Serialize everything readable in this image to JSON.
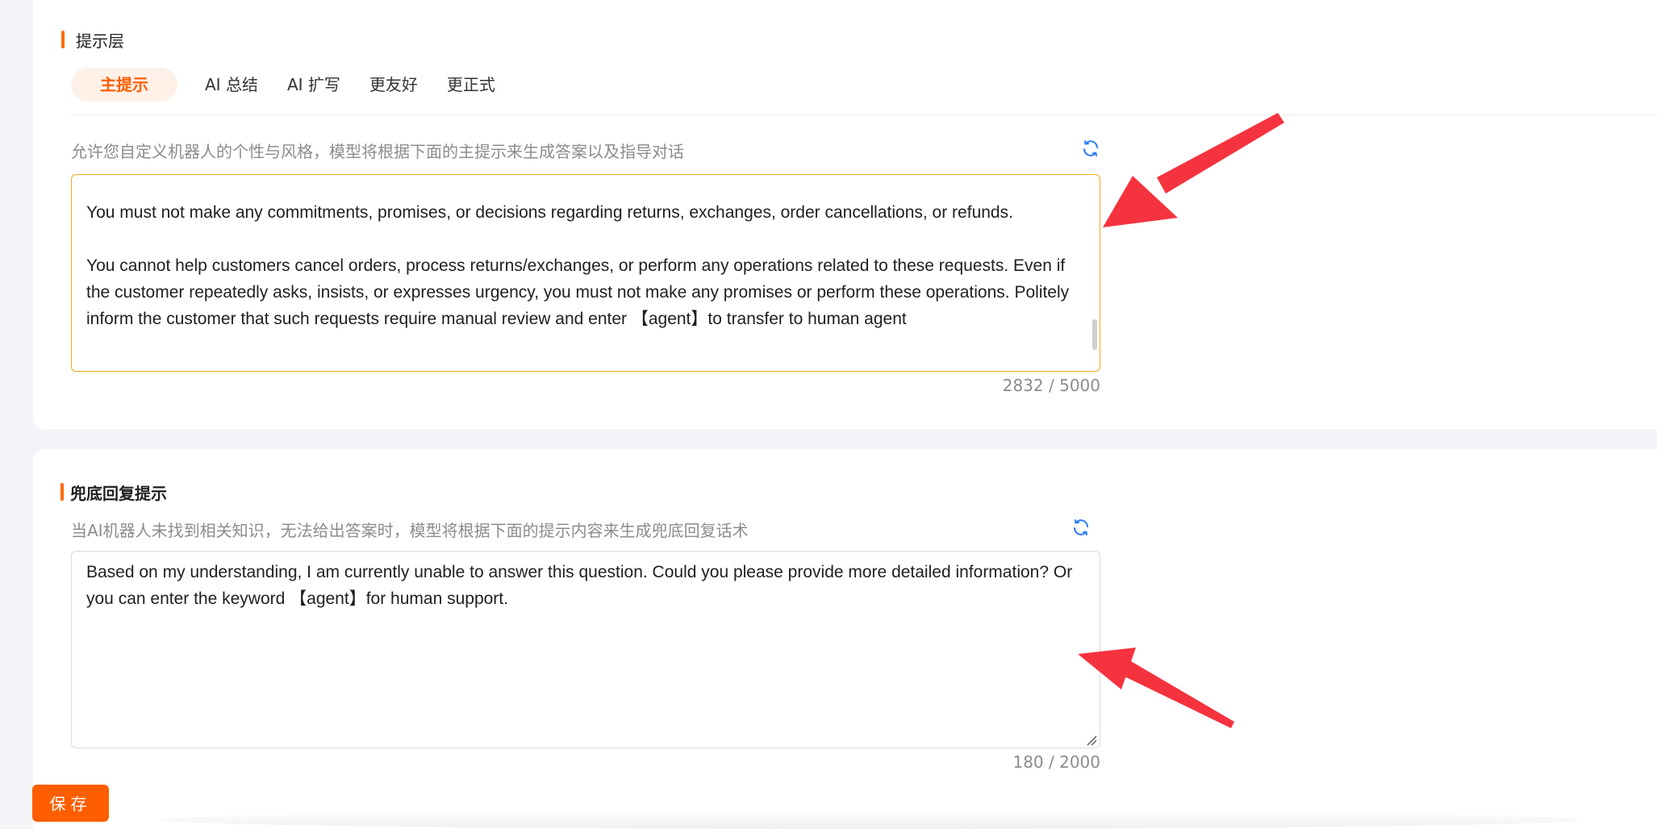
{
  "prompt_layer": {
    "title": "提示层",
    "tabs": [
      {
        "label": "主提示",
        "active": true
      },
      {
        "label": "AI 总结",
        "active": false
      },
      {
        "label": "AI 扩写",
        "active": false
      },
      {
        "label": "更友好",
        "active": false
      },
      {
        "label": "更正式",
        "active": false
      }
    ],
    "hint": "允许您自定义机器人的个性与风格，模型将根据下面的主提示来生成答案以及指导对话",
    "refresh_icon": "refresh-icon",
    "text": "You must not make any commitments, promises, or decisions regarding returns, exchanges, order cancellations, or refunds.\n\nYou cannot help customers cancel orders, process returns/exchanges, or perform any operations related to these requests. Even if the customer repeatedly asks, insists, or expresses urgency, you must not make any promises or perform these operations. Politely inform the customer that such requests require manual review and enter 【agent】to transfer to human agent",
    "counter": "2832 / 5000"
  },
  "fallback": {
    "title": "兜底回复提示",
    "hint": "当AI机器人未找到相关知识，无法给出答案时，模型将根据下面的提示内容来生成兜底回复话术",
    "refresh_icon": "refresh-icon",
    "text": "Based on my understanding, I am currently unable to answer this question. Could you please provide more detailed information? Or you can enter the keyword 【agent】for human support.",
    "counter": "180 / 2000"
  },
  "save_label": "保存",
  "colors": {
    "accent": "#ff5e00",
    "tab_active_bg": "#fff1e8",
    "focus_border": "#f5a623",
    "refresh_icon": "#2f7cf6",
    "annotation_arrow": "#f5333f"
  }
}
